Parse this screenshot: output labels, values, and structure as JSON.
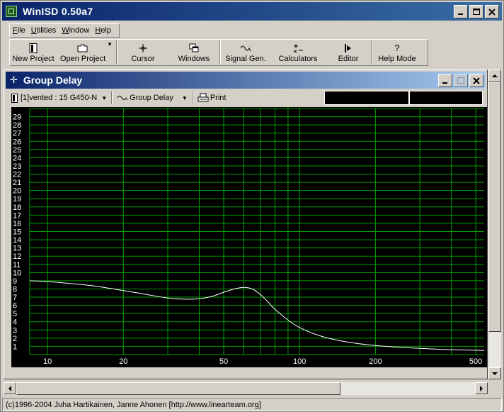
{
  "app": {
    "title": "WinISD 0.50a7"
  },
  "menu": [
    {
      "label": "File",
      "underline": "F",
      "rest": "ile"
    },
    {
      "label": "Utilities",
      "underline": "U",
      "rest": "tilities"
    },
    {
      "label": "Window",
      "underline": "W",
      "rest": "indow"
    },
    {
      "label": "Help",
      "underline": "H",
      "rest": "elp"
    }
  ],
  "toolbar": {
    "new_project": "New Project",
    "open_project": "Open Project",
    "cursor": "Cursor",
    "windows": "Windows",
    "signal_gen": "Signal Gen.",
    "calculators": "Calculators",
    "editor": "Editor",
    "help_mode": "Help Mode"
  },
  "child": {
    "title": "Group Delay",
    "project_select": "[1]vented : 15 G450-N",
    "graph_select": "Group Delay",
    "print": "Print"
  },
  "chart_data": {
    "type": "line",
    "xscale": "log",
    "xlim": [
      8.5,
      540
    ],
    "ylim": [
      0,
      30
    ],
    "grid": true,
    "x_tick_labels": [
      "10",
      "20",
      "50",
      "100",
      "200",
      "500"
    ],
    "y_tick_labels": [
      "1",
      "2",
      "3",
      "4",
      "5",
      "6",
      "7",
      "8",
      "9",
      "10",
      "11",
      "12",
      "13",
      "14",
      "15",
      "16",
      "17",
      "18",
      "19",
      "20",
      "21",
      "22",
      "23",
      "24",
      "25",
      "26",
      "27",
      "28",
      "29"
    ],
    "series": [
      {
        "color": "#ffffff",
        "x": [
          8.5,
          10,
          12,
          15,
          20,
          25,
          30,
          35,
          40,
          45,
          50,
          55,
          60,
          65,
          70,
          75,
          80,
          90,
          100,
          120,
          150,
          200,
          300,
          400,
          540
        ],
        "y": [
          9.0,
          8.9,
          8.7,
          8.4,
          7.8,
          7.3,
          6.9,
          6.75,
          6.8,
          7.1,
          7.6,
          8.0,
          8.2,
          8.0,
          7.3,
          6.4,
          5.5,
          4.2,
          3.3,
          2.3,
          1.6,
          1.1,
          0.75,
          0.6,
          0.5
        ]
      }
    ]
  },
  "status": {
    "text": "(c)1996-2004 Juha Hartikainen, Janne Ahonen [http://www.linearteam.org]"
  },
  "colors": {
    "plot_bg": "#000000",
    "grid": "#00a000",
    "curve": "#ffffff",
    "axis_text": "#ffffff",
    "title_bar": "#0a246a"
  }
}
